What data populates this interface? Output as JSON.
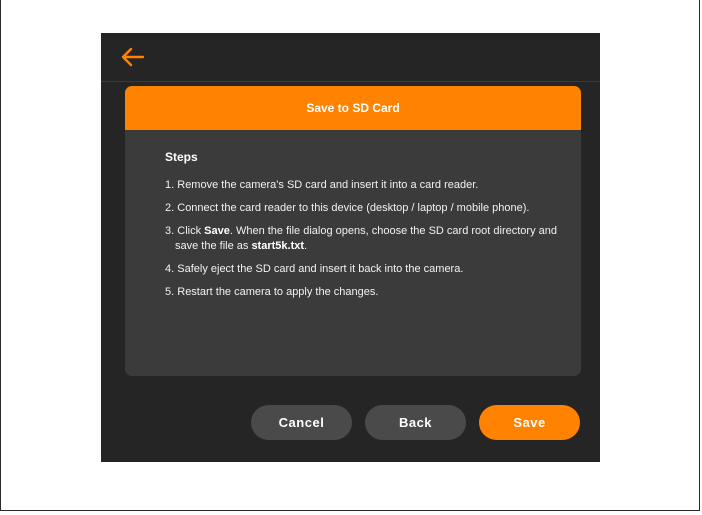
{
  "dialog": {
    "title": "Save to SD Card",
    "steps_heading": "Steps",
    "steps": [
      {
        "num": "1.",
        "text": "Remove the camera's SD card and insert it into a card reader."
      },
      {
        "num": "2.",
        "text": "Connect the card reader to this device (desktop / laptop / mobile phone)."
      },
      {
        "num": "3.",
        "pre": "Click ",
        "bold1": "Save",
        "mid": ". When the file dialog opens, choose the SD card root directory and save the file as ",
        "bold2": "start5k.txt",
        "post": "."
      },
      {
        "num": "4.",
        "text": "Safely eject the SD card and insert it back into the camera."
      },
      {
        "num": "5.",
        "text": "Restart the camera to apply the changes."
      }
    ]
  },
  "buttons": {
    "cancel": "Cancel",
    "back": "Back",
    "save": "Save"
  },
  "colors": {
    "accent": "#ff8200",
    "background": "#252525",
    "panel": "#3b3b3b",
    "button_gray": "#4a4a4a"
  },
  "icons": {
    "back": "arrow-left-icon"
  }
}
